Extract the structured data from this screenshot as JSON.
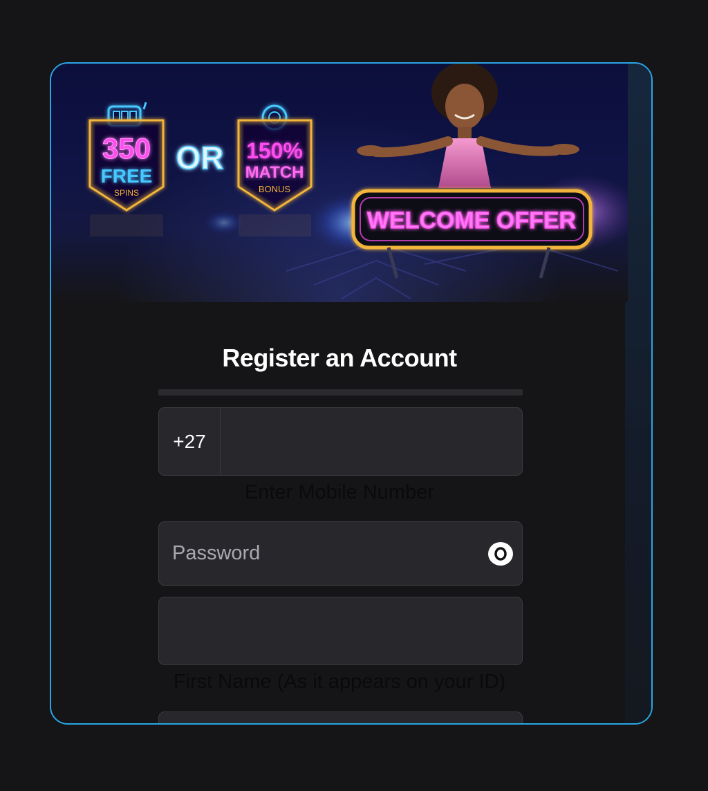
{
  "banner": {
    "badge1": {
      "top": "350",
      "middle": "FREE",
      "bottom": "SPINS"
    },
    "or_text": "OR",
    "badge2": {
      "top": "150%",
      "middle": "MATCH",
      "bottom": "BONUS"
    },
    "sign": "WELCOME OFFER"
  },
  "form": {
    "title": "Register an Account",
    "phone": {
      "prefix": "+27",
      "value": "",
      "helper": "Enter Mobile Number"
    },
    "password": {
      "placeholder": "Password"
    },
    "first_name": {
      "value": "",
      "helper": "First Name (As it appears on your ID)"
    }
  },
  "colors": {
    "border_accent": "#2aa6e6",
    "neon_pink": "#ff4df0",
    "neon_blue": "#47c8ff",
    "neon_gold": "#f2b43a",
    "field_bg": "#27272c"
  },
  "icons": {
    "password_toggle": "eye-icon"
  }
}
